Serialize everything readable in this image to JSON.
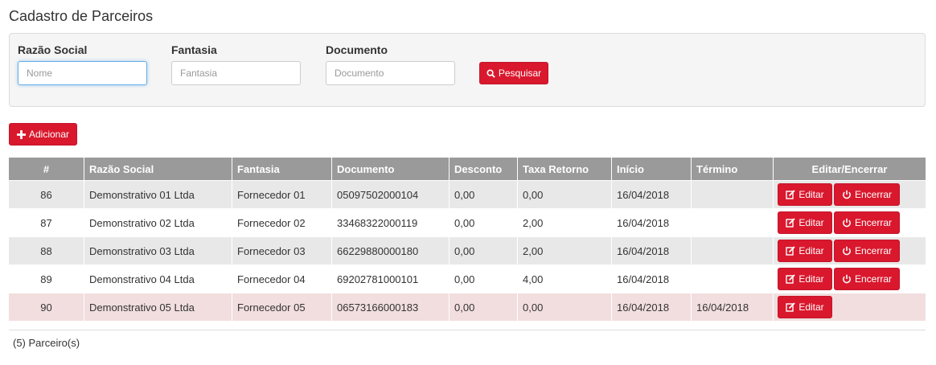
{
  "page_title": "Cadastro de Parceiros",
  "filters": {
    "razao_social": {
      "label": "Razão Social",
      "placeholder": "Nome",
      "value": ""
    },
    "fantasia": {
      "label": "Fantasia",
      "placeholder": "Fantasia",
      "value": ""
    },
    "documento": {
      "label": "Documento",
      "placeholder": "Documento",
      "value": ""
    },
    "search_label": "Pesquisar"
  },
  "add_label": "Adicionar",
  "table": {
    "headers": [
      "#",
      "Razão Social",
      "Fantasia",
      "Documento",
      "Desconto",
      "Taxa Retorno",
      "Início",
      "Término",
      "Editar/Encerrar"
    ],
    "rows": [
      {
        "id": "86",
        "razao_social": "Demonstrativo 01 Ltda",
        "fantasia": "Fornecedor 01",
        "documento": "05097502000104",
        "desconto": "0,00",
        "taxa_retorno": "0,00",
        "inicio": "16/04/2018",
        "termino": "",
        "edit_label": "Editar",
        "end_label": "Encerrar"
      },
      {
        "id": "87",
        "razao_social": "Demonstrativo 02 Ltda",
        "fantasia": "Fornecedor 02",
        "documento": "33468322000119",
        "desconto": "0,00",
        "taxa_retorno": "2,00",
        "inicio": "16/04/2018",
        "termino": "",
        "edit_label": "Editar",
        "end_label": "Encerrar"
      },
      {
        "id": "88",
        "razao_social": "Demonstrativo 03 Ltda",
        "fantasia": "Fornecedor 03",
        "documento": "66229880000180",
        "desconto": "0,00",
        "taxa_retorno": "2,00",
        "inicio": "16/04/2018",
        "termino": "",
        "edit_label": "Editar",
        "end_label": "Encerrar"
      },
      {
        "id": "89",
        "razao_social": "Demonstrativo 04 Ltda",
        "fantasia": "Fornecedor 04",
        "documento": "69202781000101",
        "desconto": "0,00",
        "taxa_retorno": "4,00",
        "inicio": "16/04/2018",
        "termino": "",
        "edit_label": "Editar",
        "end_label": "Encerrar"
      },
      {
        "id": "90",
        "razao_social": "Demonstrativo 05 Ltda",
        "fantasia": "Fornecedor 05",
        "documento": "06573166000183",
        "desconto": "0,00",
        "taxa_retorno": "0,00",
        "inicio": "16/04/2018",
        "termino": "16/04/2018",
        "edit_label": "Editar"
      }
    ]
  },
  "footer_count": "(5) Parceiro(s)",
  "colors": {
    "accent": "#d9182d",
    "header_bg": "#9a9a9a",
    "closed_row": "#f2dedf",
    "stripe": "#e8e8e8"
  },
  "icons": {
    "search": "search-icon",
    "add": "plus-icon",
    "edit": "edit-icon",
    "end": "power-icon"
  }
}
